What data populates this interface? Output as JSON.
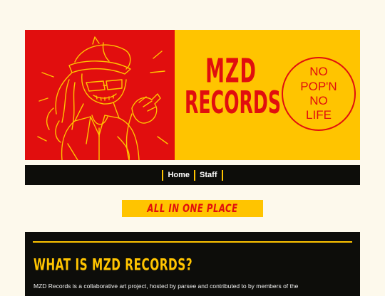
{
  "banner": {
    "logo_line1": "MZD",
    "logo_line2": "RECORDS",
    "badge_lines": [
      "NO",
      "POP'N",
      "NO",
      "LIFE"
    ],
    "colors": {
      "red": "#e10e0e",
      "yellow": "#ffc400"
    }
  },
  "nav": {
    "items": [
      {
        "label": "Home"
      },
      {
        "label": "Staff"
      }
    ]
  },
  "tagline": "ALL IN ONE PLACE",
  "about": {
    "heading": "WHAT IS MZD RECORDS?",
    "body": "MZD Records is a collaborative art project, hosted by parsee and contributed to by members of the"
  },
  "colors": {
    "page_bg": "#fdf9ec",
    "panel_bg": "#0d0d0a",
    "accent": "#ffc400"
  }
}
